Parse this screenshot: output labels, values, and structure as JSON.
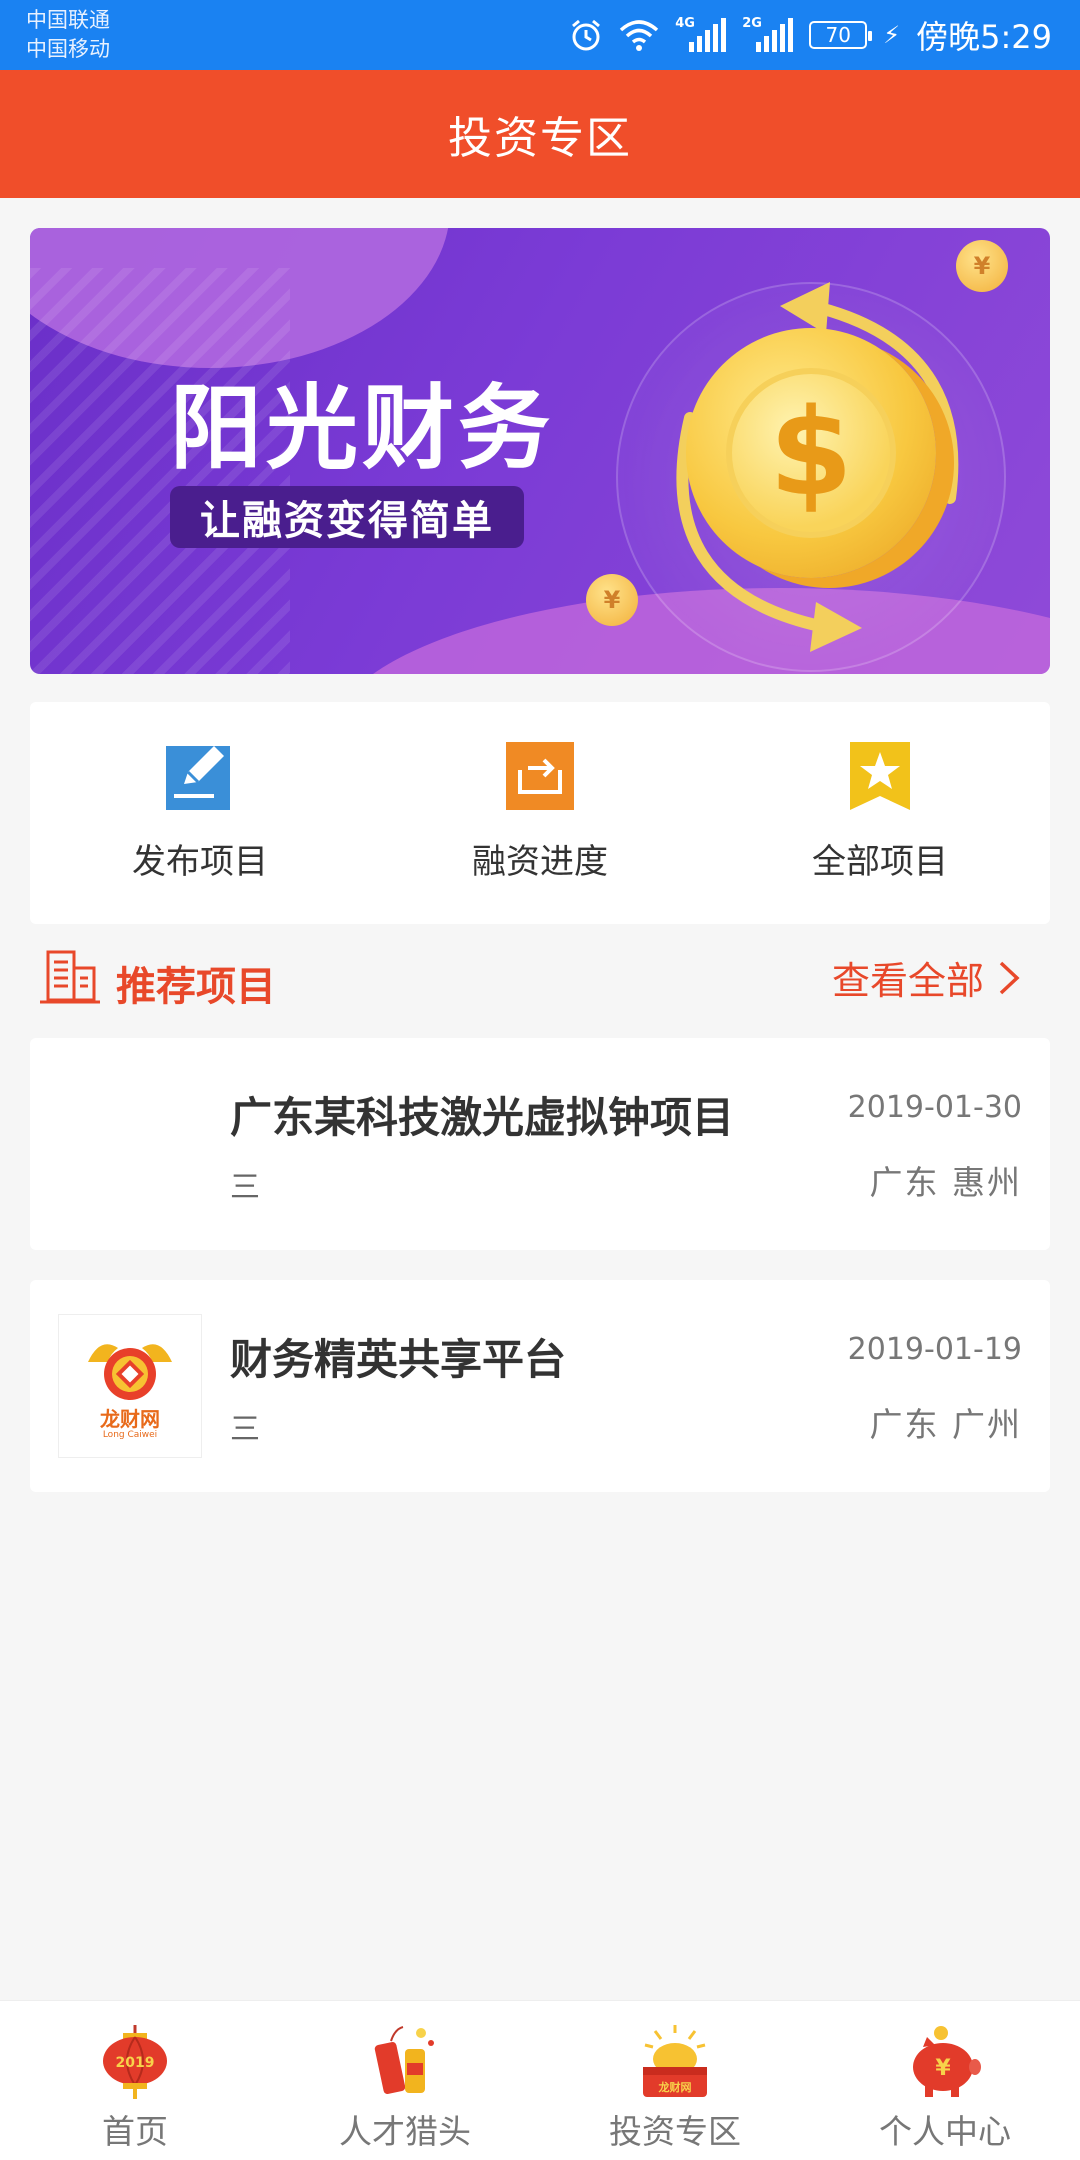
{
  "status_bar": {
    "carrier1": "中国联通",
    "carrier2": "中国移动",
    "net1": "4G",
    "net2": "2G",
    "battery": "70",
    "time": "傍晚5:29"
  },
  "header": {
    "title": "投资专区"
  },
  "banner": {
    "title": "阳光财务",
    "subtitle": "让融资变得简单",
    "coin_symbol": "$",
    "small_coin_symbol": "¥"
  },
  "actions": [
    {
      "label": "发布项目",
      "icon": "edit-icon",
      "color": "#3a8fd8"
    },
    {
      "label": "融资进度",
      "icon": "export-icon",
      "color": "#f08a24"
    },
    {
      "label": "全部项目",
      "icon": "star-icon",
      "color": "#f2c21a"
    }
  ],
  "section": {
    "title": "推荐项目",
    "view_all": "查看全部"
  },
  "projects": [
    {
      "name": "广东某科技激光虚拟钟项目",
      "meta": "三",
      "date": "2019-01-30",
      "location": "广东 惠州"
    },
    {
      "name": "财务精英共享平台",
      "meta": "三",
      "date": "2019-01-19",
      "location": "广东 广州",
      "logo_text": "龙财网",
      "logo_subtext": "Long Caiwei"
    }
  ],
  "tabs": [
    {
      "label": "首页",
      "icon": "lantern-icon"
    },
    {
      "label": "人才猎头",
      "icon": "firecracker-icon"
    },
    {
      "label": "投资专区",
      "icon": "treasure-icon"
    },
    {
      "label": "个人中心",
      "icon": "piggy-bank-icon"
    }
  ],
  "tab_icon_texts": {
    "lantern_year": "2019",
    "treasure_text": "龙财网",
    "piggy_symbol": "¥"
  },
  "colors": {
    "status_bar": "#1a82f2",
    "header": "#f04e2a",
    "accent": "#e8482a",
    "banner": "#7b3bd6"
  }
}
